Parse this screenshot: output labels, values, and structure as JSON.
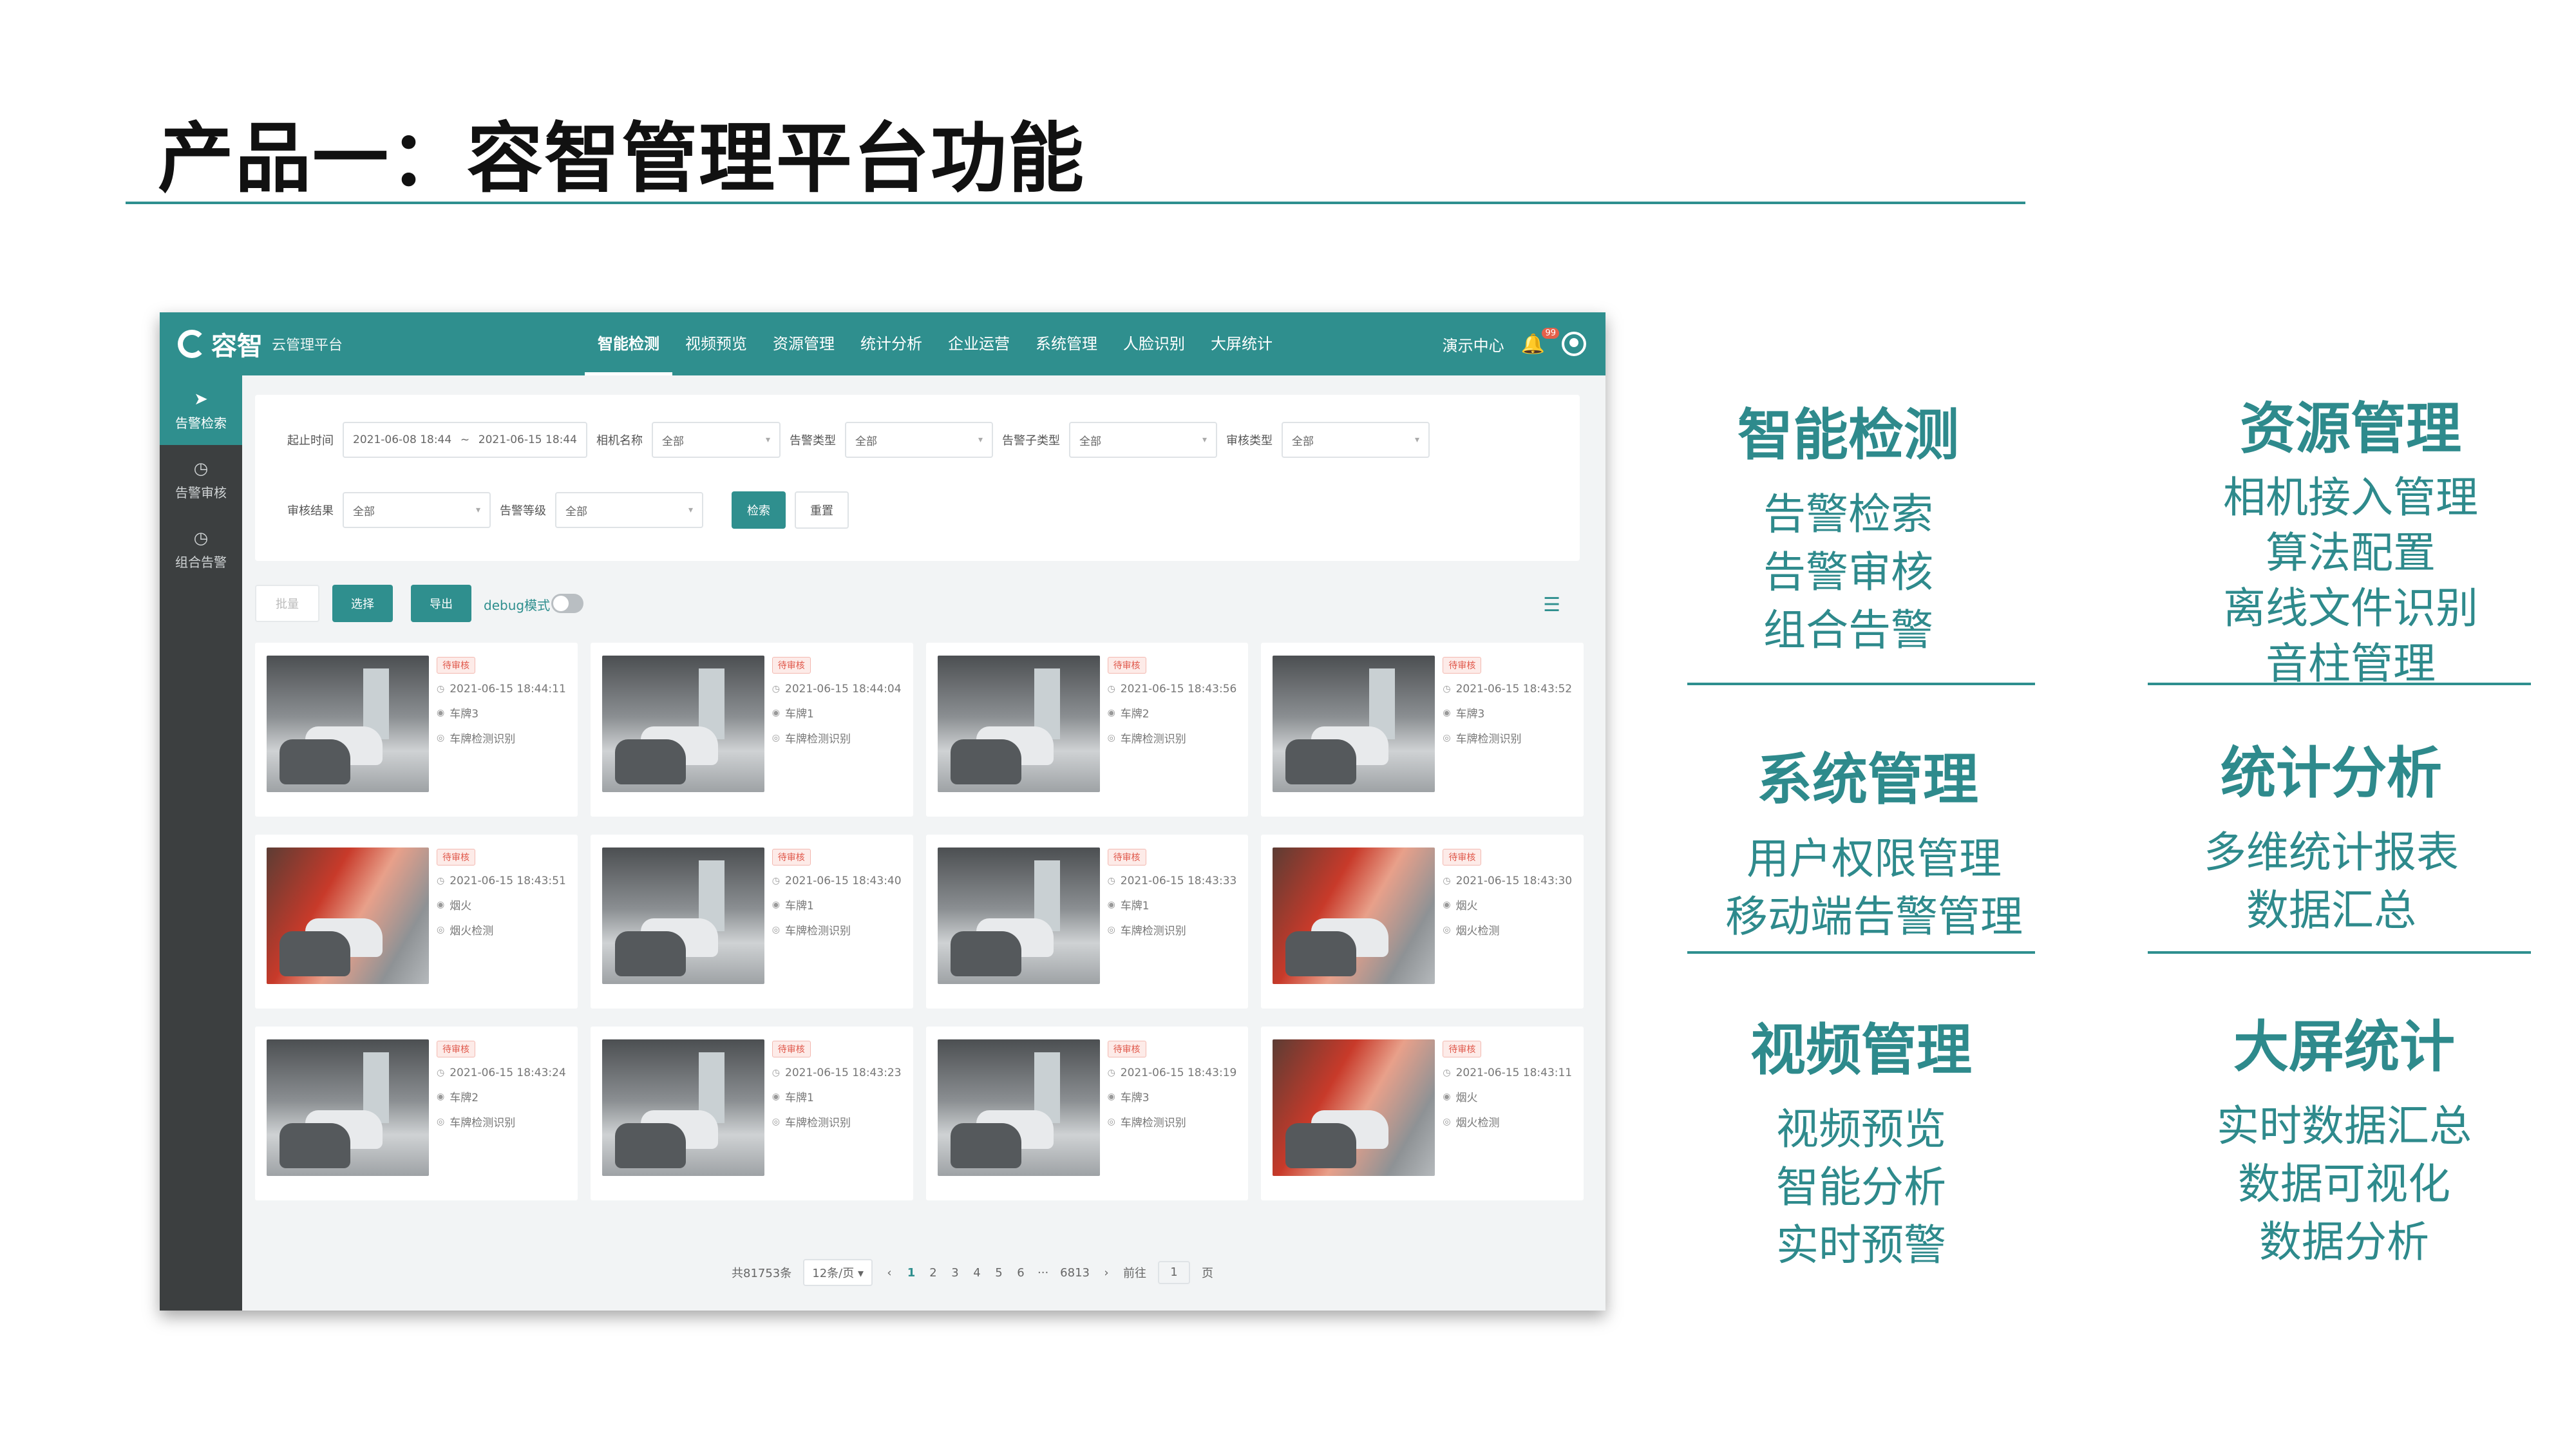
{
  "slide": {
    "title": "产品一：容智管理平台功能"
  },
  "app": {
    "logo": {
      "name": "容智",
      "subtitle": "云管理平台"
    },
    "nav": [
      "智能检测",
      "视频预览",
      "资源管理",
      "统计分析",
      "企业运营",
      "系统管理",
      "人脸识别",
      "大屏统计"
    ],
    "nav_active": "智能检测",
    "top_right": {
      "demo_label": "演示中心",
      "bell_badge": "99"
    },
    "sidebar": [
      {
        "icon": "send-icon",
        "label": "告警检索",
        "active": true
      },
      {
        "icon": "clock-icon",
        "label": "告警审核",
        "active": false
      },
      {
        "icon": "clock-icon",
        "label": "组合告警",
        "active": false
      }
    ],
    "filters": {
      "start_time_label": "起止时间",
      "start_time": "2021-06-08 18:44",
      "time_sep": "~",
      "end_time": "2021-06-15 18:44",
      "camera_label": "相机名称",
      "camera_value": "全部",
      "alarm_type_label": "告警类型",
      "alarm_type_value": "全部",
      "alarm_subtype_label": "告警子类型",
      "alarm_subtype_value": "全部",
      "review_type_label": "审核类型",
      "review_type_value": "全部",
      "review_result_label": "审核结果",
      "review_result_value": "全部",
      "alarm_level_label": "告警等级",
      "alarm_level_value": "全部",
      "search_button": "检索",
      "reset_button": "重置"
    },
    "toolbar": {
      "batch_button": "批量",
      "select_button": "选择",
      "export_button": "导出",
      "debug_label": "debug模式"
    },
    "cards": [
      {
        "tag": "待审核",
        "time": "2021-06-15 18:44:11",
        "name": "车牌3",
        "type": "车牌检测识别",
        "style": "gray"
      },
      {
        "tag": "待审核",
        "time": "2021-06-15 18:44:04",
        "name": "车牌1",
        "type": "车牌检测识别",
        "style": "gray"
      },
      {
        "tag": "待审核",
        "time": "2021-06-15 18:43:56",
        "name": "车牌2",
        "type": "车牌检测识别",
        "style": "gray"
      },
      {
        "tag": "待审核",
        "time": "2021-06-15 18:43:52",
        "name": "车牌3",
        "type": "车牌检测识别",
        "style": "gray"
      },
      {
        "tag": "待审核",
        "time": "2021-06-15 18:43:51",
        "name": "烟火",
        "type": "烟火检测",
        "style": "fire"
      },
      {
        "tag": "待审核",
        "time": "2021-06-15 18:43:40",
        "name": "车牌1",
        "type": "车牌检测识别",
        "style": "gray"
      },
      {
        "tag": "待审核",
        "time": "2021-06-15 18:43:33",
        "name": "车牌1",
        "type": "车牌检测识别",
        "style": "gray"
      },
      {
        "tag": "待审核",
        "time": "2021-06-15 18:43:30",
        "name": "烟火",
        "type": "烟火检测",
        "style": "fire"
      },
      {
        "tag": "待审核",
        "time": "2021-06-15 18:43:24",
        "name": "车牌2",
        "type": "车牌检测识别",
        "style": "gray"
      },
      {
        "tag": "待审核",
        "time": "2021-06-15 18:43:23",
        "name": "车牌1",
        "type": "车牌检测识别",
        "style": "gray"
      },
      {
        "tag": "待审核",
        "time": "2021-06-15 18:43:19",
        "name": "车牌3",
        "type": "车牌检测识别",
        "style": "gray"
      },
      {
        "tag": "待审核",
        "time": "2021-06-15 18:43:11",
        "name": "烟火",
        "type": "烟火检测",
        "style": "fire"
      }
    ],
    "pagination": {
      "total": "共81753条",
      "page_size": "12条/页",
      "prev": "‹",
      "pages": [
        "1",
        "2",
        "3",
        "4",
        "5",
        "6"
      ],
      "ellipsis": "···",
      "last_page": "6813",
      "next": "›",
      "goto_label": "前往",
      "goto_value": "1",
      "page_unit": "页"
    }
  },
  "features": [
    {
      "title": "智能检测",
      "items": [
        "告警检索",
        "告警审核",
        "组合告警"
      ]
    },
    {
      "title": "资源管理",
      "items": [
        "相机接入管理",
        "算法配置",
        "离线文件识别",
        "音柱管理"
      ]
    },
    {
      "title": "系统管理",
      "items": [
        "用户权限管理",
        "移动端告警管理"
      ]
    },
    {
      "title": "统计分析",
      "items": [
        "多维统计报表",
        "数据汇总"
      ]
    },
    {
      "title": "视频管理",
      "items": [
        "视频预览",
        "智能分析",
        "实时预警"
      ]
    },
    {
      "title": "大屏统计",
      "items": [
        "实时数据汇总",
        "数据可视化",
        "数据分析"
      ]
    }
  ],
  "colors": {
    "accent": "#2f8f8e",
    "sidebar": "#3c3f40",
    "tag": "#e0584b"
  }
}
